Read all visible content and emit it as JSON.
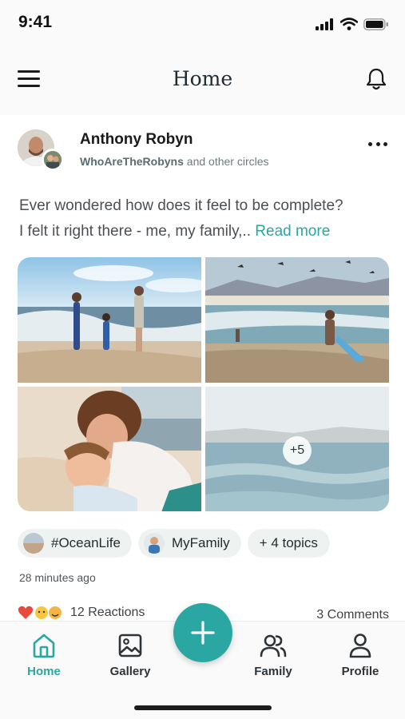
{
  "status_bar": {
    "time": "9:41"
  },
  "header": {
    "title": "Home",
    "menu_icon": "hamburger-menu-icon",
    "notification_icon": "bell-icon"
  },
  "post": {
    "author": "Anthony Robyn",
    "circle_name": "WhoAreTheRobyns",
    "circle_suffix": "and other circles",
    "text_line1": "Ever wondered how does it feel to be complete?",
    "text_line2": "I felt it right there - me, my family,..",
    "read_more": "Read more",
    "extra_photos": "+5",
    "topics": [
      "#OceanLife",
      "MyFamily",
      "+ 4 topics"
    ],
    "time_ago": "28 minutes ago",
    "reactions": "12 Reactions",
    "comments": "3 Comments"
  },
  "tabs": [
    {
      "label": "Home",
      "icon": "home-icon",
      "active": true
    },
    {
      "label": "Gallery",
      "icon": "gallery-icon",
      "active": false
    },
    {
      "label": "Family",
      "icon": "family-icon",
      "active": false
    },
    {
      "label": "Profile",
      "icon": "profile-icon",
      "active": false
    }
  ],
  "fab_icon": "plus-icon",
  "colors": {
    "accent": "#2aa6a3",
    "text": "#1e2a33",
    "chip_bg": "#eef3f1"
  }
}
